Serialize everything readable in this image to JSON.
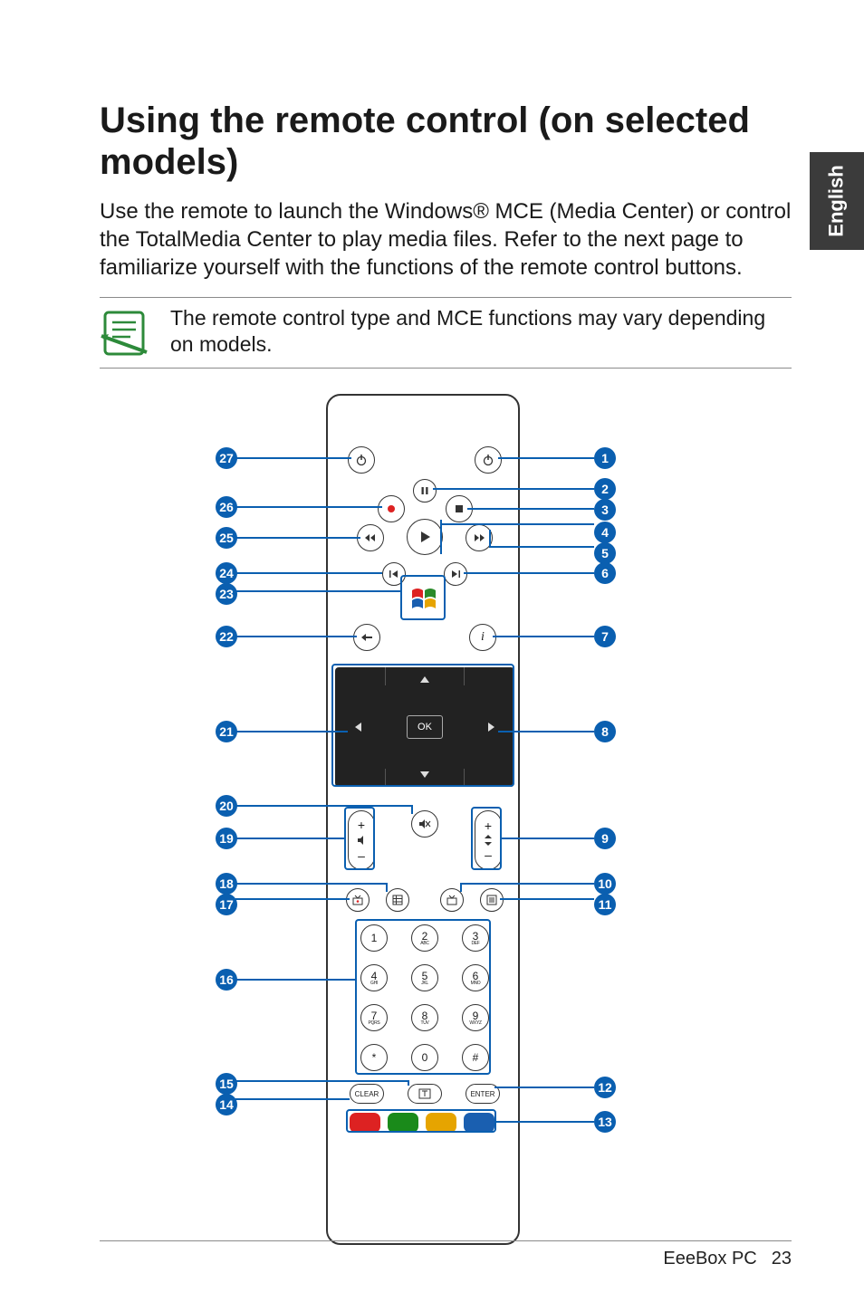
{
  "side_tab": "English",
  "heading": "Using the remote control (on selected models)",
  "intro": "Use the remote to launch the Windows® MCE (Media Center) or control the TotalMedia Center to play media files. Refer to the next page to familiarize yourself with the functions of the remote control buttons.",
  "note": "The remote control type and MCE functions may vary depending on models.",
  "callouts_right": [
    "1",
    "2",
    "3",
    "4",
    "5",
    "6",
    "7",
    "8",
    "9",
    "10",
    "11",
    "12",
    "13"
  ],
  "callouts_left": [
    "27",
    "26",
    "25",
    "24",
    "23",
    "22",
    "21",
    "20",
    "19",
    "18",
    "17",
    "16",
    "15",
    "14"
  ],
  "remote": {
    "ok_label": "OK",
    "clear_label": "CLEAR",
    "enter_label": "ENTER",
    "keypad": [
      {
        "n": "1",
        "sub": ""
      },
      {
        "n": "2",
        "sub": "ABC"
      },
      {
        "n": "3",
        "sub": "DEF"
      },
      {
        "n": "4",
        "sub": "GHI"
      },
      {
        "n": "5",
        "sub": "JKL"
      },
      {
        "n": "6",
        "sub": "MNO"
      },
      {
        "n": "7",
        "sub": "PQRS"
      },
      {
        "n": "8",
        "sub": "TUV"
      },
      {
        "n": "9",
        "sub": "WXYZ"
      },
      {
        "n": "*",
        "sub": ""
      },
      {
        "n": "0",
        "sub": ""
      },
      {
        "n": "#",
        "sub": ""
      }
    ],
    "color_keys": [
      "#d22",
      "#1a8a1a",
      "#e6a400",
      "#1a5fb0"
    ],
    "info_label": "i",
    "plus": "+",
    "minus": "–"
  },
  "footer": {
    "product": "EeeBox PC",
    "page": "23"
  }
}
